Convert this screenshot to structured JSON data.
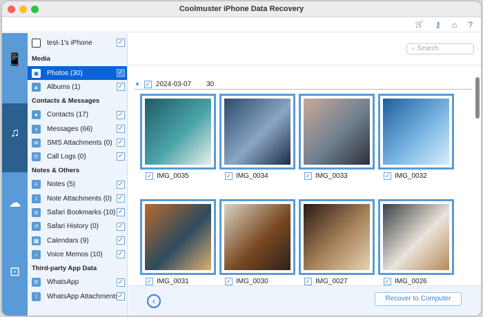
{
  "window": {
    "title": "Coolmuster iPhone Data Recovery"
  },
  "toolbar": {
    "icons": [
      "cart-icon",
      "key-icon",
      "home-icon",
      "help-icon"
    ],
    "cart": "🛒",
    "key": "⚷",
    "home": "⌂",
    "help": "?"
  },
  "device": {
    "name": "test-1's iPhone"
  },
  "sidebar": {
    "media_header": "Media",
    "media": [
      {
        "label": "Photos (30)",
        "icon": "▣"
      },
      {
        "label": "Albums (1)",
        "icon": "▲"
      }
    ],
    "contacts_header": "Contacts & Messages",
    "contacts": [
      {
        "label": "Contacts (17)",
        "icon": "●"
      },
      {
        "label": "Messages (66)",
        "icon": "◖"
      },
      {
        "label": "SMS Attachments (0)",
        "icon": "✉"
      },
      {
        "label": "Call Logs (0)",
        "icon": "✆"
      }
    ],
    "notes_header": "Notes & Others",
    "notes": [
      {
        "label": "Notes (5)",
        "icon": "≡"
      },
      {
        "label": "Note Attachments (0)",
        "icon": "⌇"
      },
      {
        "label": "Safari Bookmarks (10)",
        "icon": "⊘"
      },
      {
        "label": "Safari History (0)",
        "icon": "↺"
      },
      {
        "label": "Calendars (9)",
        "icon": "▦"
      },
      {
        "label": "Voice Memos (10)",
        "icon": "♪"
      }
    ],
    "third_header": "Third-party App Data",
    "third": [
      {
        "label": "WhatsApp",
        "icon": "✆"
      },
      {
        "label": "WhatsApp Attachments",
        "icon": "⌇"
      }
    ]
  },
  "search": {
    "placeholder": "Search"
  },
  "group": {
    "date": "2024-03-07",
    "count": "30"
  },
  "photos": [
    {
      "name": "IMG_0035",
      "colors": [
        "#1f5b66",
        "#4aa3a8",
        "#e8efe8"
      ]
    },
    {
      "name": "IMG_0034",
      "colors": [
        "#2d4a6b",
        "#8aa6c4",
        "#1b2d45"
      ]
    },
    {
      "name": "IMG_0033",
      "colors": [
        "#c7a99a",
        "#6f7f8e",
        "#2b3038"
      ]
    },
    {
      "name": "IMG_0032",
      "colors": [
        "#1f5e9c",
        "#78b5e3",
        "#d7ecfa"
      ]
    },
    {
      "name": "IMG_0031",
      "colors": [
        "#b86a2a",
        "#2c4b5e",
        "#e0b070"
      ]
    },
    {
      "name": "IMG_0030",
      "colors": [
        "#d9d2c4",
        "#7a4a24",
        "#2e2018"
      ]
    },
    {
      "name": "IMG_0027",
      "colors": [
        "#2a1a12",
        "#a9845c",
        "#e7d3b2"
      ]
    },
    {
      "name": "IMG_0026",
      "colors": [
        "#3b4046",
        "#e9e4da",
        "#b8895a"
      ]
    }
  ],
  "footer": {
    "back": "‹",
    "recover_label": "Recover to Computer"
  }
}
